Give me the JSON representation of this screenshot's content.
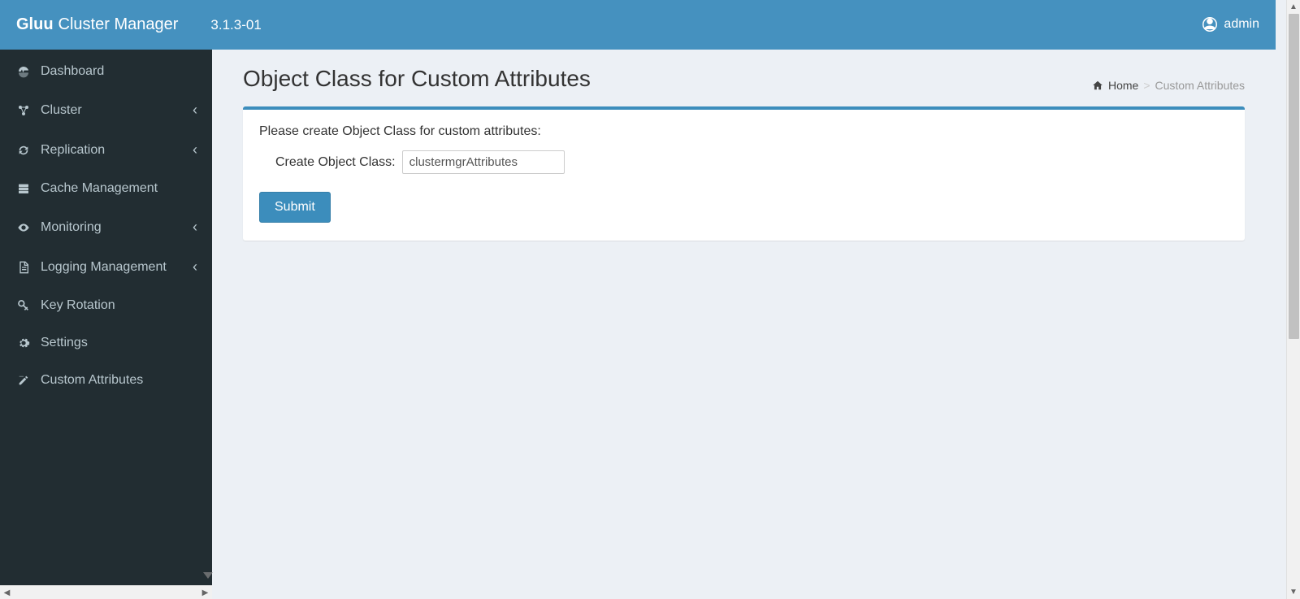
{
  "header": {
    "brand_strong": "Gluu",
    "brand_rest": "Cluster Manager",
    "version": "3.1.3-01",
    "user": "admin"
  },
  "sidebar": {
    "items": [
      {
        "label": "Dashboard",
        "icon": "dashboard",
        "expandable": false
      },
      {
        "label": "Cluster",
        "icon": "cluster",
        "expandable": true
      },
      {
        "label": "Replication",
        "icon": "refresh",
        "expandable": true
      },
      {
        "label": "Cache Management",
        "icon": "server",
        "expandable": false
      },
      {
        "label": "Monitoring",
        "icon": "eye",
        "expandable": true
      },
      {
        "label": "Logging Management",
        "icon": "file",
        "expandable": true
      },
      {
        "label": "Key Rotation",
        "icon": "key",
        "expandable": false
      },
      {
        "label": "Settings",
        "icon": "gear",
        "expandable": false
      },
      {
        "label": "Custom Attributes",
        "icon": "edit",
        "expandable": false
      }
    ]
  },
  "page": {
    "title": "Object Class for Custom Attributes",
    "breadcrumb_home": "Home",
    "breadcrumb_current": "Custom Attributes"
  },
  "panel": {
    "intro": "Please create Object Class for custom attributes:",
    "input_label": "Create Object Class:",
    "input_value": "clustermgrAttributes",
    "submit_label": "Submit"
  },
  "icons": {
    "dashboard": "dashboard-icon",
    "cluster": "cluster-icon",
    "refresh": "refresh-icon",
    "server": "server-icon",
    "eye": "eye-icon",
    "file": "file-icon",
    "key": "key-icon",
    "gear": "gear-icon",
    "edit": "edit-icon"
  }
}
